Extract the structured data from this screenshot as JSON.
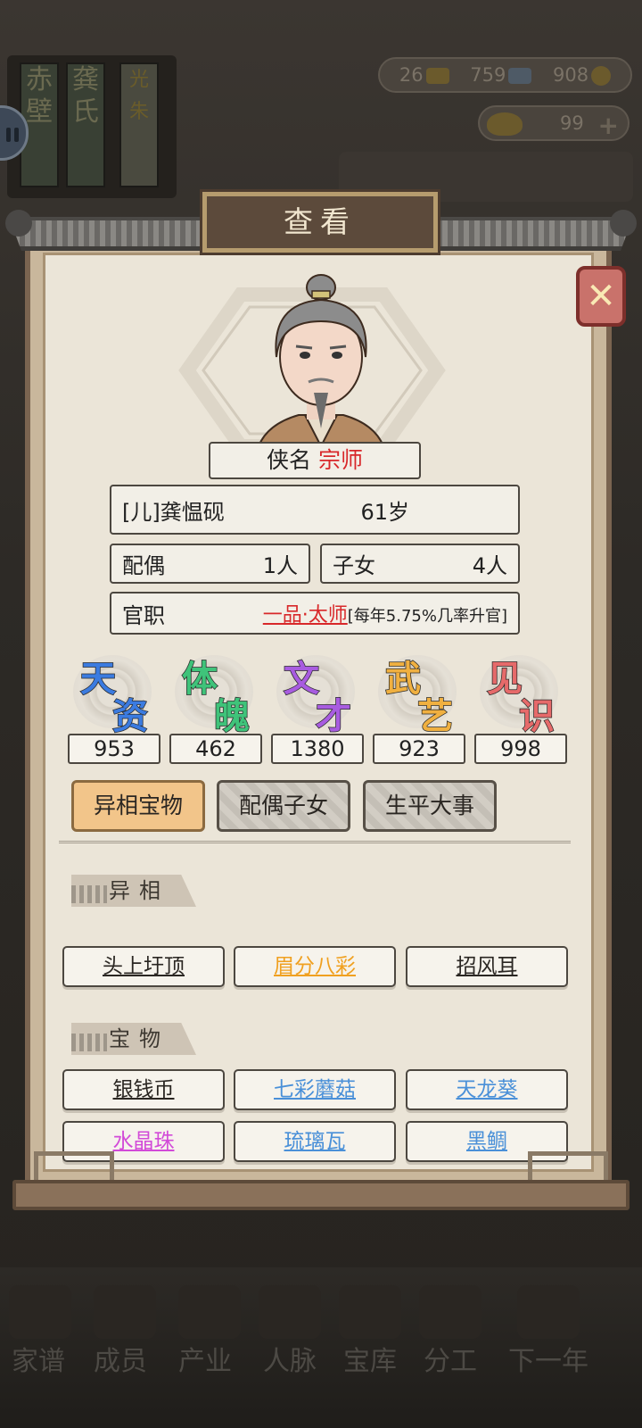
{
  "background": {
    "book_titles": [
      "赤壁",
      "龚氏",
      "光朱"
    ],
    "currency": {
      "copper": "26",
      "silver": "759",
      "coins": "908"
    },
    "gold": "99",
    "nav": [
      "家谱",
      "成员",
      "产业",
      "人脉",
      "宝库",
      "分工",
      "下一年"
    ]
  },
  "dialog": {
    "title": "查看",
    "close_label": "✕",
    "title_label": "侠名",
    "title_value": "宗师",
    "name": "[儿]龚愠砚",
    "age": "61岁",
    "spouse_label": "配偶",
    "spouse_value": "1人",
    "children_label": "子女",
    "children_value": "4人",
    "office_label": "官职",
    "office_value": "一品·太师",
    "office_note": "[每年5.75%几率升官]"
  },
  "stats": [
    {
      "c1": "天",
      "c2": "资",
      "value": "953",
      "color": "#3b7be0"
    },
    {
      "c1": "体",
      "c2": "魄",
      "value": "462",
      "color": "#3fc37a"
    },
    {
      "c1": "文",
      "c2": "才",
      "value": "1380",
      "color": "#a85ce0"
    },
    {
      "c1": "武",
      "c2": "艺",
      "value": "923",
      "color": "#f0b040"
    },
    {
      "c1": "见",
      "c2": "识",
      "value": "998",
      "color": "#e66a6a"
    }
  ],
  "tabs": [
    "异相宝物",
    "配偶子女",
    "生平大事"
  ],
  "sections": {
    "traits_title": "异相",
    "traits": [
      "头上圩顶",
      "眉分八彩",
      "招风耳"
    ],
    "treasures_title": "宝物",
    "treasures": [
      "银钱币",
      "七彩蘑菇",
      "天龙葵",
      "水晶珠",
      "琉璃瓦",
      "黑鲷"
    ]
  },
  "colors": {
    "accent_red": "#d8282a",
    "tab_active": "#f2c58a",
    "rare_orange": "#f0a020",
    "rare_blue": "#4a90d8",
    "rare_purple": "#d24ad8"
  }
}
